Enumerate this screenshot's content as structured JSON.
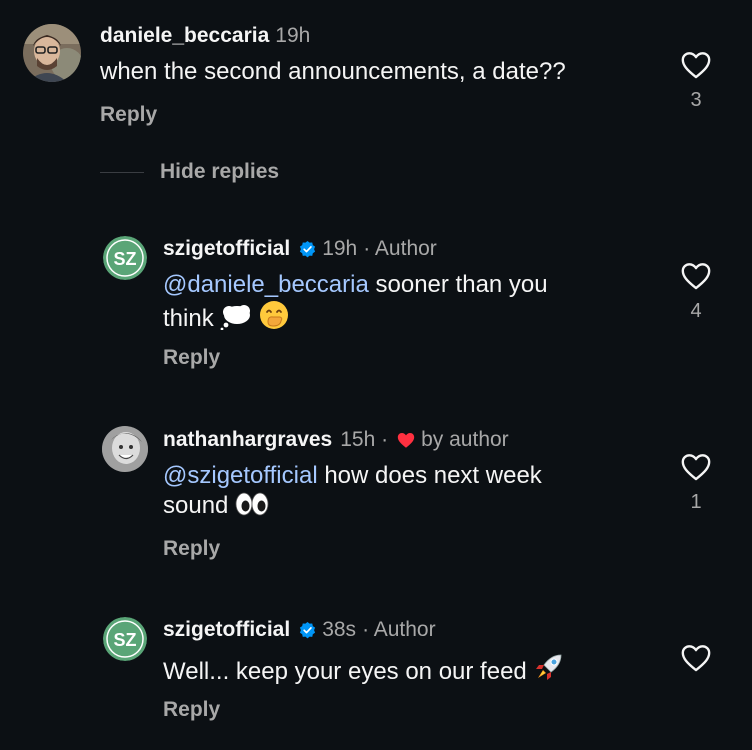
{
  "comments": [
    {
      "username": "daniele_beccaria",
      "time": "19h",
      "author_tag": "",
      "mention": "",
      "text_lines": [
        "when the second announcements, a date??"
      ],
      "reply_label": "Reply",
      "like_count": "3",
      "verified": false
    },
    {
      "username": "szigetofficial",
      "time": "19h",
      "author_tag": "· Author",
      "mention": "@daniele_beccaria",
      "text_line1_rest": " sooner than you",
      "text_line2": "think",
      "reply_label": "Reply",
      "like_count": "4",
      "verified": true
    },
    {
      "username": "nathanhargraves",
      "time": "15h ·",
      "liked_by": "by author",
      "mention": "@szigetofficial",
      "text_line1_rest": " how does next week",
      "text_line2": "sound",
      "reply_label": "Reply",
      "like_count": "1",
      "verified": false
    },
    {
      "username": "szigetofficial",
      "time": "38s",
      "author_tag": "· Author",
      "text": "Well... keep your eyes on our feed",
      "reply_label": "Reply",
      "like_count": "",
      "verified": true
    }
  ],
  "hide_replies": "Hide replies",
  "avatar_initials": "SZ",
  "icons": {
    "like": "heart-outline-icon",
    "verified": "verified-badge-icon",
    "liked_by_author": "red-heart-icon"
  },
  "colors": {
    "background": "#0c1014",
    "mention": "#a5c8ff",
    "verified": "#0095f6",
    "sziget_avatar": "#5aa577",
    "liked_heart": "#ff3040"
  }
}
